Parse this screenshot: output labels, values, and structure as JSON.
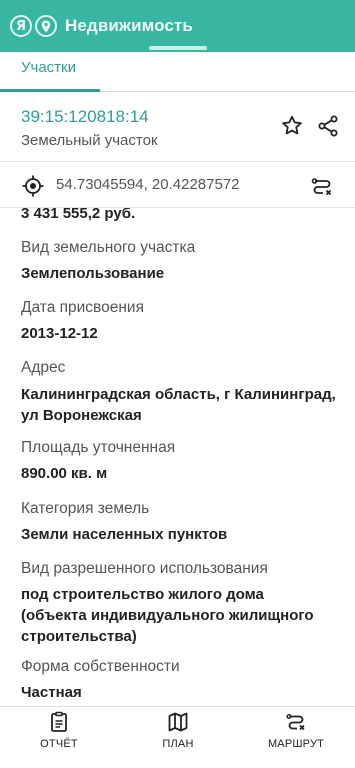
{
  "header": {
    "logo_glyph": "Я",
    "title": "Недвижимость"
  },
  "tabs": [
    {
      "label": "Участки",
      "active": true
    }
  ],
  "parcel": {
    "cadastral_number": "39:15:120818:14",
    "type": "Земельный участок"
  },
  "coords": {
    "text": "54.73045594, 20.42287572"
  },
  "details": {
    "cut_value": "3 431 555,2 руб.",
    "fields": [
      {
        "label": "Вид земельного участка",
        "value": "Землепользование"
      },
      {
        "label": "Дата присвоения",
        "value": "2013-12-12"
      },
      {
        "label": "Адрес",
        "value": "Калининградская область, г Калининград, ул Воронежская"
      },
      {
        "label": "Площадь уточненная",
        "value": "890.00 кв. м"
      },
      {
        "label": "Категория земель",
        "value": "Земли населенных пунктов"
      },
      {
        "label": "Вид разрешенного использования",
        "value": "под строительство жилого дома (объекта индивидуального жилищного строительства)"
      },
      {
        "label": "Форма собственности",
        "value": "Частная"
      }
    ]
  },
  "bottom_nav": [
    {
      "label": "ОТЧЁТ",
      "icon": "report-icon"
    },
    {
      "label": "ПЛАН",
      "icon": "map-icon"
    },
    {
      "label": "МАРШРУТ",
      "icon": "route-icon"
    }
  ],
  "colors": {
    "header_bg": "#39b6a2",
    "accent": "#2f9e90"
  }
}
